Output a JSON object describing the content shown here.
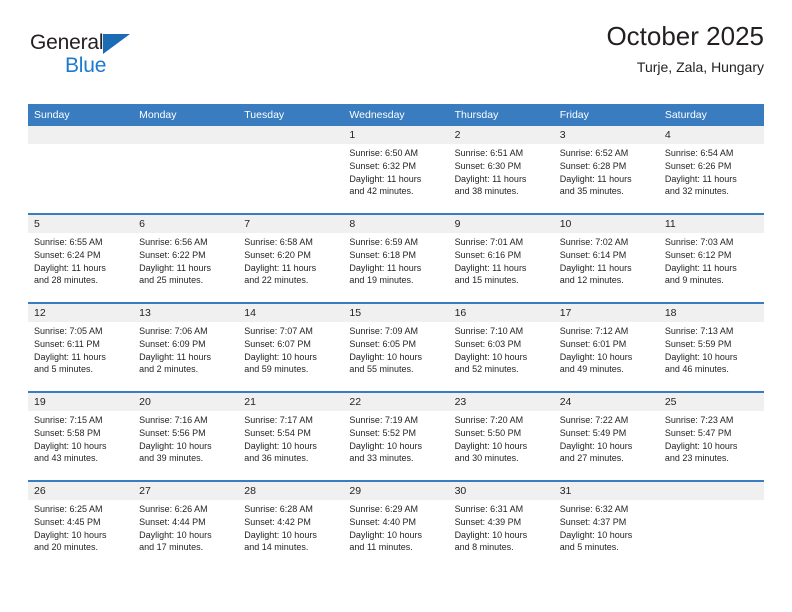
{
  "brand": {
    "name_top": "General",
    "name_bottom": "Blue",
    "triangle_color": "#1b6cb5",
    "blue_color": "#1b7ad1"
  },
  "header": {
    "title": "October 2025",
    "subtitle": "Turje, Zala, Hungary",
    "accent_color": "#3a7cc0",
    "daynum_band_color": "#f0f0f0"
  },
  "weekdays": [
    "Sunday",
    "Monday",
    "Tuesday",
    "Wednesday",
    "Thursday",
    "Friday",
    "Saturday"
  ],
  "labels": {
    "sunrise_prefix": "Sunrise:",
    "sunset_prefix": "Sunset:",
    "daylight_prefix": "Daylight:"
  },
  "weeks": [
    [
      {
        "day": "",
        "sunrise": "",
        "sunset": "",
        "daylight_a": "",
        "daylight_b": ""
      },
      {
        "day": "",
        "sunrise": "",
        "sunset": "",
        "daylight_a": "",
        "daylight_b": ""
      },
      {
        "day": "",
        "sunrise": "",
        "sunset": "",
        "daylight_a": "",
        "daylight_b": ""
      },
      {
        "day": "1",
        "sunrise": "Sunrise: 6:50 AM",
        "sunset": "Sunset: 6:32 PM",
        "daylight_a": "Daylight: 11 hours",
        "daylight_b": "and 42 minutes."
      },
      {
        "day": "2",
        "sunrise": "Sunrise: 6:51 AM",
        "sunset": "Sunset: 6:30 PM",
        "daylight_a": "Daylight: 11 hours",
        "daylight_b": "and 38 minutes."
      },
      {
        "day": "3",
        "sunrise": "Sunrise: 6:52 AM",
        "sunset": "Sunset: 6:28 PM",
        "daylight_a": "Daylight: 11 hours",
        "daylight_b": "and 35 minutes."
      },
      {
        "day": "4",
        "sunrise": "Sunrise: 6:54 AM",
        "sunset": "Sunset: 6:26 PM",
        "daylight_a": "Daylight: 11 hours",
        "daylight_b": "and 32 minutes."
      }
    ],
    [
      {
        "day": "5",
        "sunrise": "Sunrise: 6:55 AM",
        "sunset": "Sunset: 6:24 PM",
        "daylight_a": "Daylight: 11 hours",
        "daylight_b": "and 28 minutes."
      },
      {
        "day": "6",
        "sunrise": "Sunrise: 6:56 AM",
        "sunset": "Sunset: 6:22 PM",
        "daylight_a": "Daylight: 11 hours",
        "daylight_b": "and 25 minutes."
      },
      {
        "day": "7",
        "sunrise": "Sunrise: 6:58 AM",
        "sunset": "Sunset: 6:20 PM",
        "daylight_a": "Daylight: 11 hours",
        "daylight_b": "and 22 minutes."
      },
      {
        "day": "8",
        "sunrise": "Sunrise: 6:59 AM",
        "sunset": "Sunset: 6:18 PM",
        "daylight_a": "Daylight: 11 hours",
        "daylight_b": "and 19 minutes."
      },
      {
        "day": "9",
        "sunrise": "Sunrise: 7:01 AM",
        "sunset": "Sunset: 6:16 PM",
        "daylight_a": "Daylight: 11 hours",
        "daylight_b": "and 15 minutes."
      },
      {
        "day": "10",
        "sunrise": "Sunrise: 7:02 AM",
        "sunset": "Sunset: 6:14 PM",
        "daylight_a": "Daylight: 11 hours",
        "daylight_b": "and 12 minutes."
      },
      {
        "day": "11",
        "sunrise": "Sunrise: 7:03 AM",
        "sunset": "Sunset: 6:12 PM",
        "daylight_a": "Daylight: 11 hours",
        "daylight_b": "and 9 minutes."
      }
    ],
    [
      {
        "day": "12",
        "sunrise": "Sunrise: 7:05 AM",
        "sunset": "Sunset: 6:11 PM",
        "daylight_a": "Daylight: 11 hours",
        "daylight_b": "and 5 minutes."
      },
      {
        "day": "13",
        "sunrise": "Sunrise: 7:06 AM",
        "sunset": "Sunset: 6:09 PM",
        "daylight_a": "Daylight: 11 hours",
        "daylight_b": "and 2 minutes."
      },
      {
        "day": "14",
        "sunrise": "Sunrise: 7:07 AM",
        "sunset": "Sunset: 6:07 PM",
        "daylight_a": "Daylight: 10 hours",
        "daylight_b": "and 59 minutes."
      },
      {
        "day": "15",
        "sunrise": "Sunrise: 7:09 AM",
        "sunset": "Sunset: 6:05 PM",
        "daylight_a": "Daylight: 10 hours",
        "daylight_b": "and 55 minutes."
      },
      {
        "day": "16",
        "sunrise": "Sunrise: 7:10 AM",
        "sunset": "Sunset: 6:03 PM",
        "daylight_a": "Daylight: 10 hours",
        "daylight_b": "and 52 minutes."
      },
      {
        "day": "17",
        "sunrise": "Sunrise: 7:12 AM",
        "sunset": "Sunset: 6:01 PM",
        "daylight_a": "Daylight: 10 hours",
        "daylight_b": "and 49 minutes."
      },
      {
        "day": "18",
        "sunrise": "Sunrise: 7:13 AM",
        "sunset": "Sunset: 5:59 PM",
        "daylight_a": "Daylight: 10 hours",
        "daylight_b": "and 46 minutes."
      }
    ],
    [
      {
        "day": "19",
        "sunrise": "Sunrise: 7:15 AM",
        "sunset": "Sunset: 5:58 PM",
        "daylight_a": "Daylight: 10 hours",
        "daylight_b": "and 43 minutes."
      },
      {
        "day": "20",
        "sunrise": "Sunrise: 7:16 AM",
        "sunset": "Sunset: 5:56 PM",
        "daylight_a": "Daylight: 10 hours",
        "daylight_b": "and 39 minutes."
      },
      {
        "day": "21",
        "sunrise": "Sunrise: 7:17 AM",
        "sunset": "Sunset: 5:54 PM",
        "daylight_a": "Daylight: 10 hours",
        "daylight_b": "and 36 minutes."
      },
      {
        "day": "22",
        "sunrise": "Sunrise: 7:19 AM",
        "sunset": "Sunset: 5:52 PM",
        "daylight_a": "Daylight: 10 hours",
        "daylight_b": "and 33 minutes."
      },
      {
        "day": "23",
        "sunrise": "Sunrise: 7:20 AM",
        "sunset": "Sunset: 5:50 PM",
        "daylight_a": "Daylight: 10 hours",
        "daylight_b": "and 30 minutes."
      },
      {
        "day": "24",
        "sunrise": "Sunrise: 7:22 AM",
        "sunset": "Sunset: 5:49 PM",
        "daylight_a": "Daylight: 10 hours",
        "daylight_b": "and 27 minutes."
      },
      {
        "day": "25",
        "sunrise": "Sunrise: 7:23 AM",
        "sunset": "Sunset: 5:47 PM",
        "daylight_a": "Daylight: 10 hours",
        "daylight_b": "and 23 minutes."
      }
    ],
    [
      {
        "day": "26",
        "sunrise": "Sunrise: 6:25 AM",
        "sunset": "Sunset: 4:45 PM",
        "daylight_a": "Daylight: 10 hours",
        "daylight_b": "and 20 minutes."
      },
      {
        "day": "27",
        "sunrise": "Sunrise: 6:26 AM",
        "sunset": "Sunset: 4:44 PM",
        "daylight_a": "Daylight: 10 hours",
        "daylight_b": "and 17 minutes."
      },
      {
        "day": "28",
        "sunrise": "Sunrise: 6:28 AM",
        "sunset": "Sunset: 4:42 PM",
        "daylight_a": "Daylight: 10 hours",
        "daylight_b": "and 14 minutes."
      },
      {
        "day": "29",
        "sunrise": "Sunrise: 6:29 AM",
        "sunset": "Sunset: 4:40 PM",
        "daylight_a": "Daylight: 10 hours",
        "daylight_b": "and 11 minutes."
      },
      {
        "day": "30",
        "sunrise": "Sunrise: 6:31 AM",
        "sunset": "Sunset: 4:39 PM",
        "daylight_a": "Daylight: 10 hours",
        "daylight_b": "and 8 minutes."
      },
      {
        "day": "31",
        "sunrise": "Sunrise: 6:32 AM",
        "sunset": "Sunset: 4:37 PM",
        "daylight_a": "Daylight: 10 hours",
        "daylight_b": "and 5 minutes."
      },
      {
        "day": "",
        "sunrise": "",
        "sunset": "",
        "daylight_a": "",
        "daylight_b": ""
      }
    ]
  ]
}
